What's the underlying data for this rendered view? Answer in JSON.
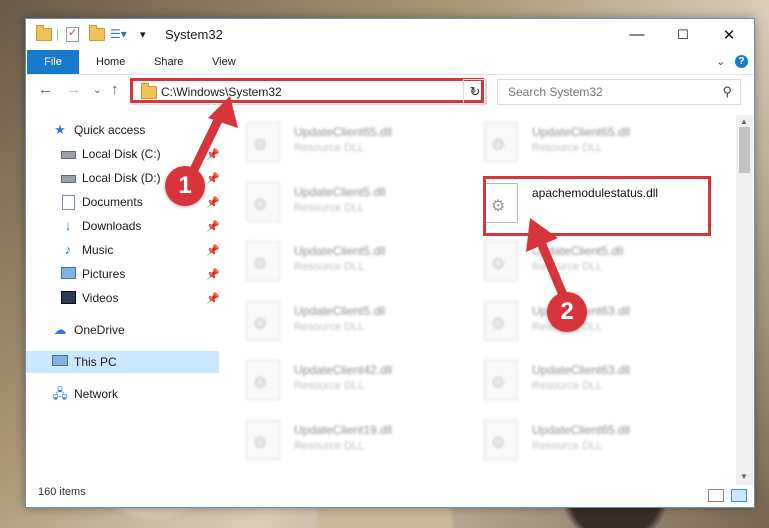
{
  "window": {
    "title": "System32",
    "controls": {
      "minimize": "—",
      "maximize": "☐",
      "close": "✕"
    }
  },
  "ribbon": {
    "tabs": [
      "File",
      "Home",
      "Share",
      "View"
    ],
    "help": "?"
  },
  "address": {
    "path": "C:\\Windows\\System32",
    "search_placeholder": "Search System32"
  },
  "nav": {
    "items": [
      {
        "label": "Quick access",
        "icon": "star-icon"
      },
      {
        "label": "Local Disk (C:)",
        "icon": "drive-icon"
      },
      {
        "label": "Local Disk (D:)",
        "icon": "drive-icon"
      },
      {
        "label": "Documents",
        "icon": "documents-icon"
      },
      {
        "label": "Downloads",
        "icon": "download-icon"
      },
      {
        "label": "Music",
        "icon": "music-icon"
      },
      {
        "label": "Pictures",
        "icon": "pictures-icon"
      },
      {
        "label": "Videos",
        "icon": "videos-icon"
      },
      {
        "label": "OneDrive",
        "icon": "cloud-icon"
      },
      {
        "label": "This PC",
        "icon": "computer-icon"
      },
      {
        "label": "Network",
        "icon": "network-icon"
      }
    ]
  },
  "files": {
    "col1": [
      {
        "name": "UpdateClient65.dll",
        "type": "Resource DLL"
      },
      {
        "name": "UpdateClient5.dll",
        "type": "Resource DLL"
      },
      {
        "name": "UpdateClient5.dll",
        "type": "Resource DLL"
      },
      {
        "name": "UpdateClient5.dll",
        "type": "Resource DLL"
      },
      {
        "name": "UpdateClient42.dll",
        "type": "Resource DLL"
      },
      {
        "name": "UpdateClient19.dll",
        "type": "Resource DLL"
      }
    ],
    "col2": [
      {
        "name": "UpdateClient65.dll",
        "type": "Resource DLL"
      },
      {
        "name": "apachemodulestatus.dll",
        "type": ""
      },
      {
        "name": "UpdateClient5.dll",
        "type": "Resource DLL"
      },
      {
        "name": "UpdateClient63.dll",
        "type": "Resource DLL"
      },
      {
        "name": "UpdateClient63.dll",
        "type": "Resource DLL"
      },
      {
        "name": "UpdateClient65.dll",
        "type": "Resource DLL"
      }
    ]
  },
  "status": {
    "item_count": "160 items"
  },
  "annotations": {
    "step1": "1",
    "step2": "2",
    "color": "#d8343c"
  }
}
